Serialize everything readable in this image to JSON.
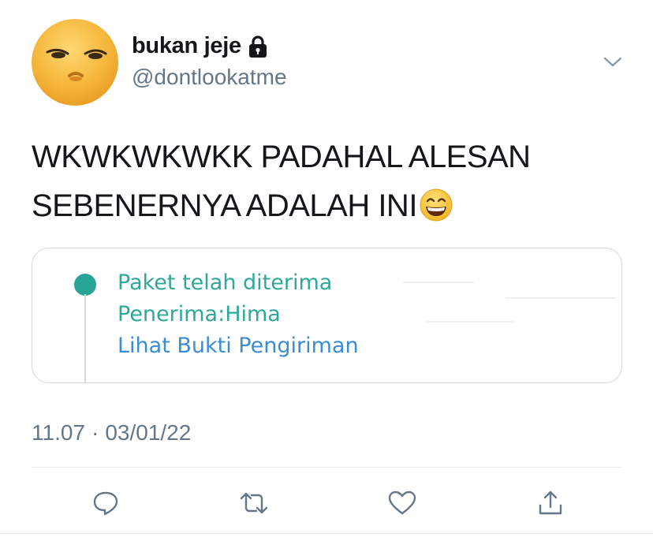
{
  "user": {
    "display_name": "bukan jeje",
    "handle": "@dontlookatme"
  },
  "tweet": {
    "lines": [
      "WKWKWKWKK PADAHAL ALESAN",
      "SEBENERNYA ADALAH INI"
    ],
    "emoji": "grinning-face-with-smiling-eyes-icon"
  },
  "media": {
    "status": "Paket telah diterima",
    "recipient_label": "Penerima:",
    "recipient_value": "Hima",
    "proof_link": "Lihat Bukti Pengiriman",
    "colors": {
      "green": "#2fa89a",
      "blue": "#3c8cd2",
      "dot": "#27a493"
    }
  },
  "meta": {
    "time": "11.07",
    "separator": "·",
    "date": "03/01/22"
  },
  "actions": [
    "reply-icon",
    "retweet-icon",
    "like-icon",
    "share-icon"
  ],
  "colors": {
    "text": "#14171a",
    "secondary": "#657786",
    "border": "#cfd9de"
  }
}
